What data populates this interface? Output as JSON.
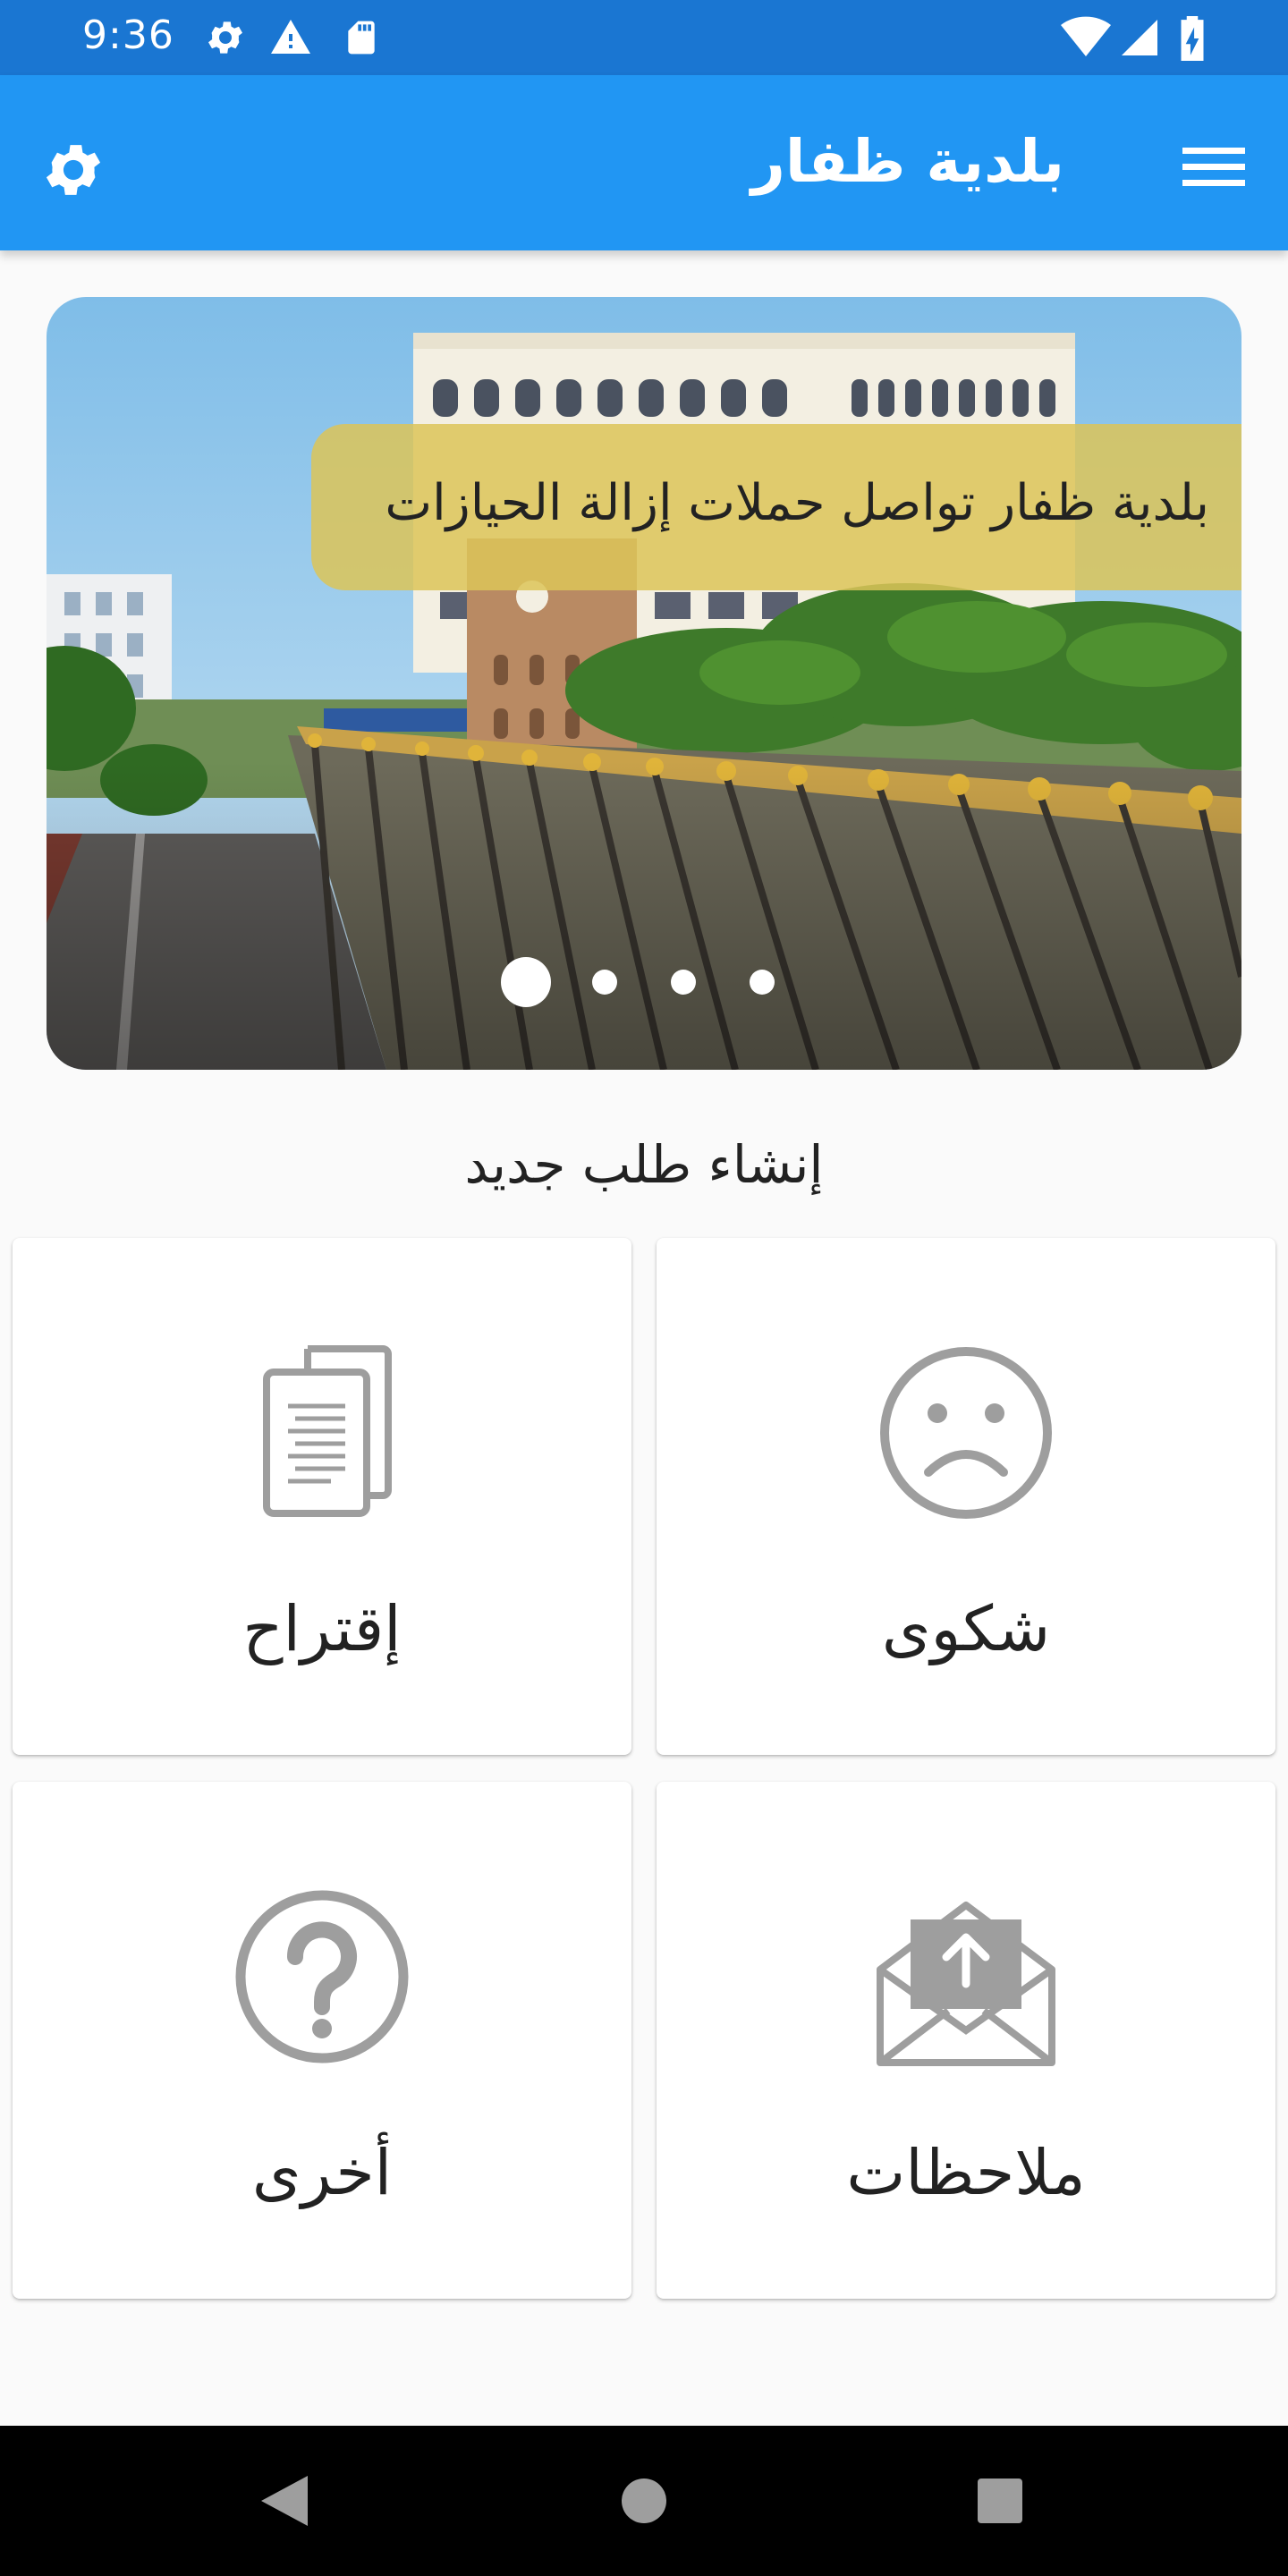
{
  "status_bar": {
    "time": "9:36",
    "left_icons": [
      "settings-icon",
      "warning-icon",
      "sd-card-icon"
    ],
    "right_icons": [
      "wifi-icon",
      "signal-icon",
      "battery-charging-icon"
    ]
  },
  "app_bar": {
    "title": "بلدية ظفار",
    "menu_icon": "menu-icon",
    "settings_icon": "settings-icon",
    "color": "#2196f3"
  },
  "banner": {
    "caption": "بلدية ظفار تواصل حملات إزالة الحيازات",
    "slide_count": 4,
    "active_slide": 1
  },
  "new_request": {
    "title": "إنشاء طلب جديد",
    "options": [
      {
        "label": "شكوى",
        "icon": "sad-face-icon"
      },
      {
        "label": "إقتراح",
        "icon": "documents-icon"
      },
      {
        "label": "ملاحظات",
        "icon": "mail-upload-icon"
      },
      {
        "label": "أخرى",
        "icon": "question-icon"
      }
    ]
  },
  "nav_bar": {
    "buttons": [
      "back-icon",
      "home-icon",
      "recents-icon"
    ]
  }
}
